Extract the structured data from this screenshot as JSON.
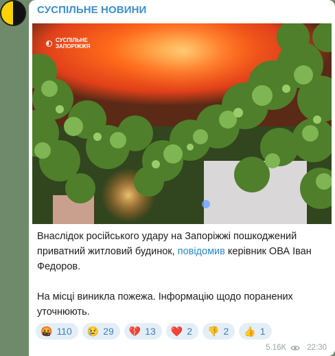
{
  "channel": {
    "name": "СУСПІЛЬНЕ НОВИНИ"
  },
  "photo": {
    "watermark_line1": "СУСПІЛЬНЕ",
    "watermark_line2": "ЗАПОРІЖЖЯ"
  },
  "message": {
    "p1_before": "Внаслідок російського удару на Запоріжжі пошкоджений приватний житловий будинок, ",
    "p1_link": "повідомив",
    "p1_after": " керівник ОВА Іван Федоров.",
    "p2": "На місці виникла пожежа. Інформацію щодо поранених уточнюють."
  },
  "reactions": [
    {
      "emoji": "🤬",
      "icon": "enraged-face-icon",
      "count": "110"
    },
    {
      "emoji": "😢",
      "icon": "crying-face-icon",
      "count": "29"
    },
    {
      "emoji": "💔",
      "icon": "broken-heart-icon",
      "count": "13"
    },
    {
      "emoji": "❤️",
      "icon": "red-heart-icon",
      "count": "2"
    },
    {
      "emoji": "👎",
      "icon": "thumbs-down-icon",
      "count": "2"
    },
    {
      "emoji": "👍",
      "icon": "thumbs-up-icon",
      "count": "1"
    }
  ],
  "meta": {
    "views": "5.16K",
    "time": "22:30"
  },
  "colors": {
    "accent": "#3a8dcc",
    "reaction_bg": "#e4eef7",
    "fire": "#ff5a14"
  }
}
